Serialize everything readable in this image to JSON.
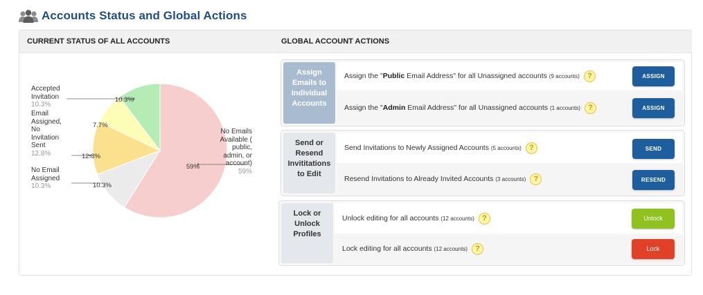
{
  "header": {
    "title": "Accounts Status and Global Actions",
    "icon": "people-icon"
  },
  "left_panel": {
    "title": "CURRENT STATUS OF ALL ACCOUNTS"
  },
  "right_panel": {
    "title": "GLOBAL ACCOUNT ACTIONS"
  },
  "chart_data": {
    "type": "pie",
    "slices": [
      {
        "label": "No Emails Available ( public, admin, or account)",
        "value": 59,
        "pct": "59%",
        "color": "#f6cece"
      },
      {
        "label": "No Email Assigned",
        "value": 10.3,
        "pct": "10.3%",
        "color": "#ebebeb"
      },
      {
        "label": "Email Assigned, No Invitation Sent",
        "value": 12.8,
        "pct": "12.8%",
        "color": "#fbe18d"
      },
      {
        "label": "Accepted Invitation",
        "value": 7.7,
        "pct": "7.7%",
        "color": "#fdfdb8"
      },
      {
        "label": "",
        "value": 10.3,
        "pct": "10.3%",
        "color": "#b5ecb5"
      }
    ],
    "labels": {
      "accepted": {
        "line1": "Accepted",
        "line2": "Invitation",
        "pct": "10.3%"
      },
      "email_assigned": {
        "line1": "Email",
        "line2": "Assigned,",
        "line3": "No",
        "line4": "Invitation",
        "line5": "Sent",
        "pct": "12.8%"
      },
      "no_email": {
        "line1": "No Email",
        "line2": "Assigned",
        "pct": "10.3%"
      },
      "no_emails": {
        "line1": "No Emails",
        "line2": "Available (",
        "line3": "public,",
        "line4": "admin, or",
        "line5": "account)",
        "pct": "59%"
      }
    },
    "inner_labels": {
      "s59": "59%",
      "s10a": "10.3%",
      "s128": "12.8%",
      "s77": "7.7%",
      "s10b": "10.3%"
    }
  },
  "groups": {
    "assign": {
      "label": "Assign Emails to Individual Accounts",
      "row1": {
        "pre": "Assign the \"",
        "bold": "Public",
        "post": " Email Address\" for all Unassigned accounts ",
        "small": "(9 accounts)",
        "button": "ASSIGN"
      },
      "row2": {
        "pre": "Assign the \"",
        "bold": "Admin",
        "post": " Email Address\" for all Unassigned accounts ",
        "small": "(1 accounts)",
        "button": "ASSIGN"
      }
    },
    "invite": {
      "label": "Send or Resend Invititations to Edit",
      "row1": {
        "text": "Send Invitations to Newly Assigned Accounts ",
        "small": "(5 accounts)",
        "button": "SEND"
      },
      "row2": {
        "text": "Resend Invitations to Already Invited Accounts ",
        "small": "(3 accounts)",
        "button": "RESEND"
      }
    },
    "lock": {
      "label": "Lock or Unlock Profiles",
      "row1": {
        "text": "Unlock editing for all accounts ",
        "small": "(12 accounts)",
        "button": "Unlock"
      },
      "row2": {
        "text": "Lock editing for all accounts ",
        "small": "(12 accounts)",
        "button": "Lock"
      }
    }
  },
  "help_glyph": "?"
}
